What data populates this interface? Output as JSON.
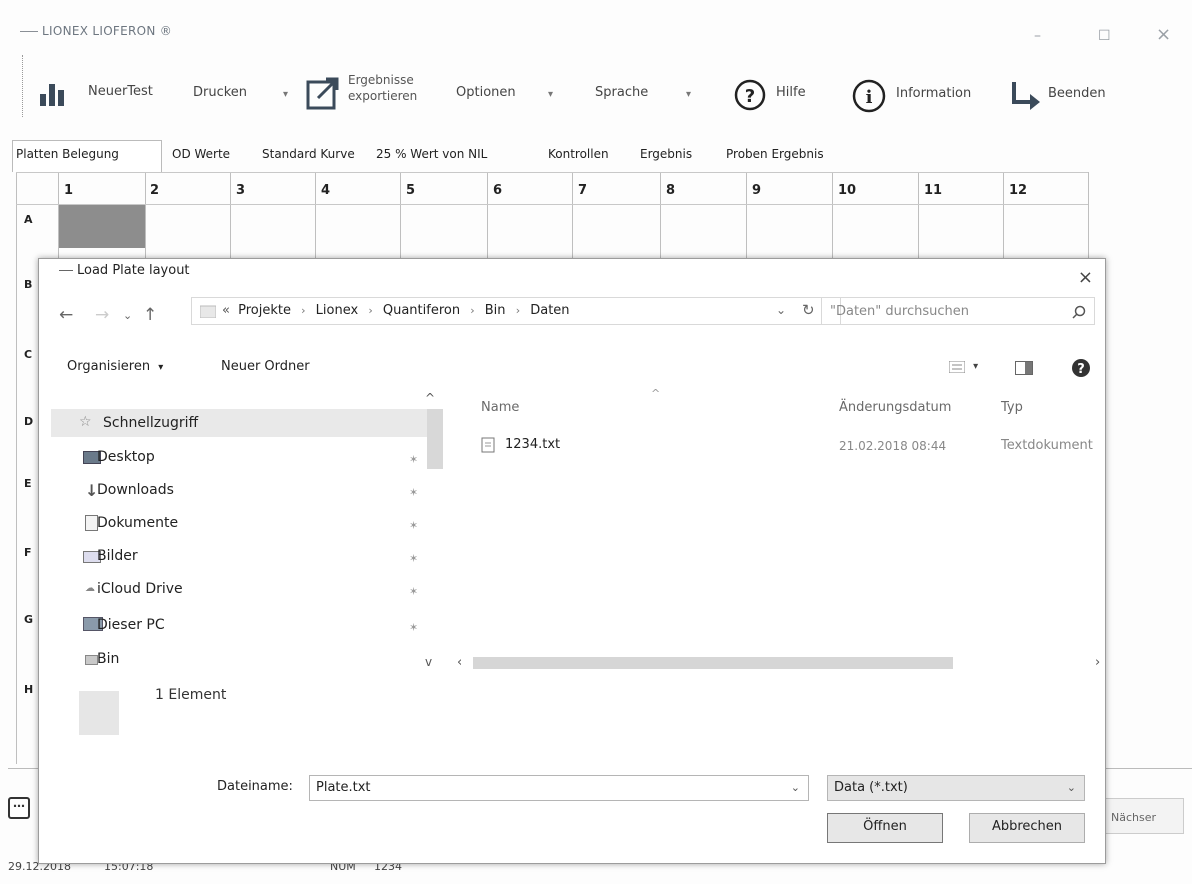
{
  "app": {
    "title": "LIONEX LIOFERON ®",
    "win_min": "–",
    "win_max": "☐",
    "win_close": "×"
  },
  "toolbar": {
    "new_test": "NeuerTest",
    "print": "Drucken",
    "export_line1": "Ergebnisse",
    "export_line2": "exportieren",
    "options": "Optionen",
    "language": "Sprache",
    "help": "Hilfe",
    "information": "Information",
    "exit": "Beenden"
  },
  "tabs": [
    "Platten Belegung",
    "OD Werte",
    "Standard Kurve",
    "25 % Wert von NIL",
    "Kontrollen",
    "Ergebnis",
    "Proben Ergebnis"
  ],
  "grid": {
    "columns": [
      "1",
      "2",
      "3",
      "4",
      "5",
      "6",
      "7",
      "8",
      "9",
      "10",
      "11",
      "12"
    ],
    "rows": [
      "A",
      "B",
      "C",
      "D",
      "E",
      "F",
      "G",
      "H"
    ]
  },
  "footer": {
    "next": "Nächser"
  },
  "status": {
    "date": "29.12.2018",
    "time": "15:07:18",
    "num": "NUM",
    "value": "1234"
  },
  "dialog": {
    "title": "Load Plate layout",
    "close": "×",
    "breadcrumb": [
      "«",
      "Projekte",
      "Lionex",
      "Quantiferon",
      "Bin",
      "Daten"
    ],
    "search_placeholder": "\"Daten\" durchsuchen",
    "organize": "Organisieren",
    "new_folder": "Neuer Ordner",
    "nav_items": [
      {
        "label": "Schnellzugriff",
        "icon": "star-icon"
      },
      {
        "label": "Desktop",
        "icon": "desktop-icon"
      },
      {
        "label": "Downloads",
        "icon": "download-icon"
      },
      {
        "label": "Dokumente",
        "icon": "document-icon"
      },
      {
        "label": "Bilder",
        "icon": "picture-icon"
      },
      {
        "label": "iCloud Drive",
        "icon": "cloud-icon"
      },
      {
        "label": "Dieser PC",
        "icon": "computer-icon"
      },
      {
        "label": "Bin",
        "icon": "folder-icon"
      }
    ],
    "columns": {
      "name": "Name",
      "date": "Änderungsdatum",
      "type": "Typ"
    },
    "files": [
      {
        "name": "1234.txt",
        "date": "21.02.2018 08:44",
        "type": "Textdokument"
      }
    ],
    "item_count": "1 Element",
    "filename_label": "Dateiname:",
    "filename_value": "Plate.txt",
    "filter_value": "Data (*.txt)",
    "open": "Öffnen",
    "cancel": "Abbrechen"
  }
}
